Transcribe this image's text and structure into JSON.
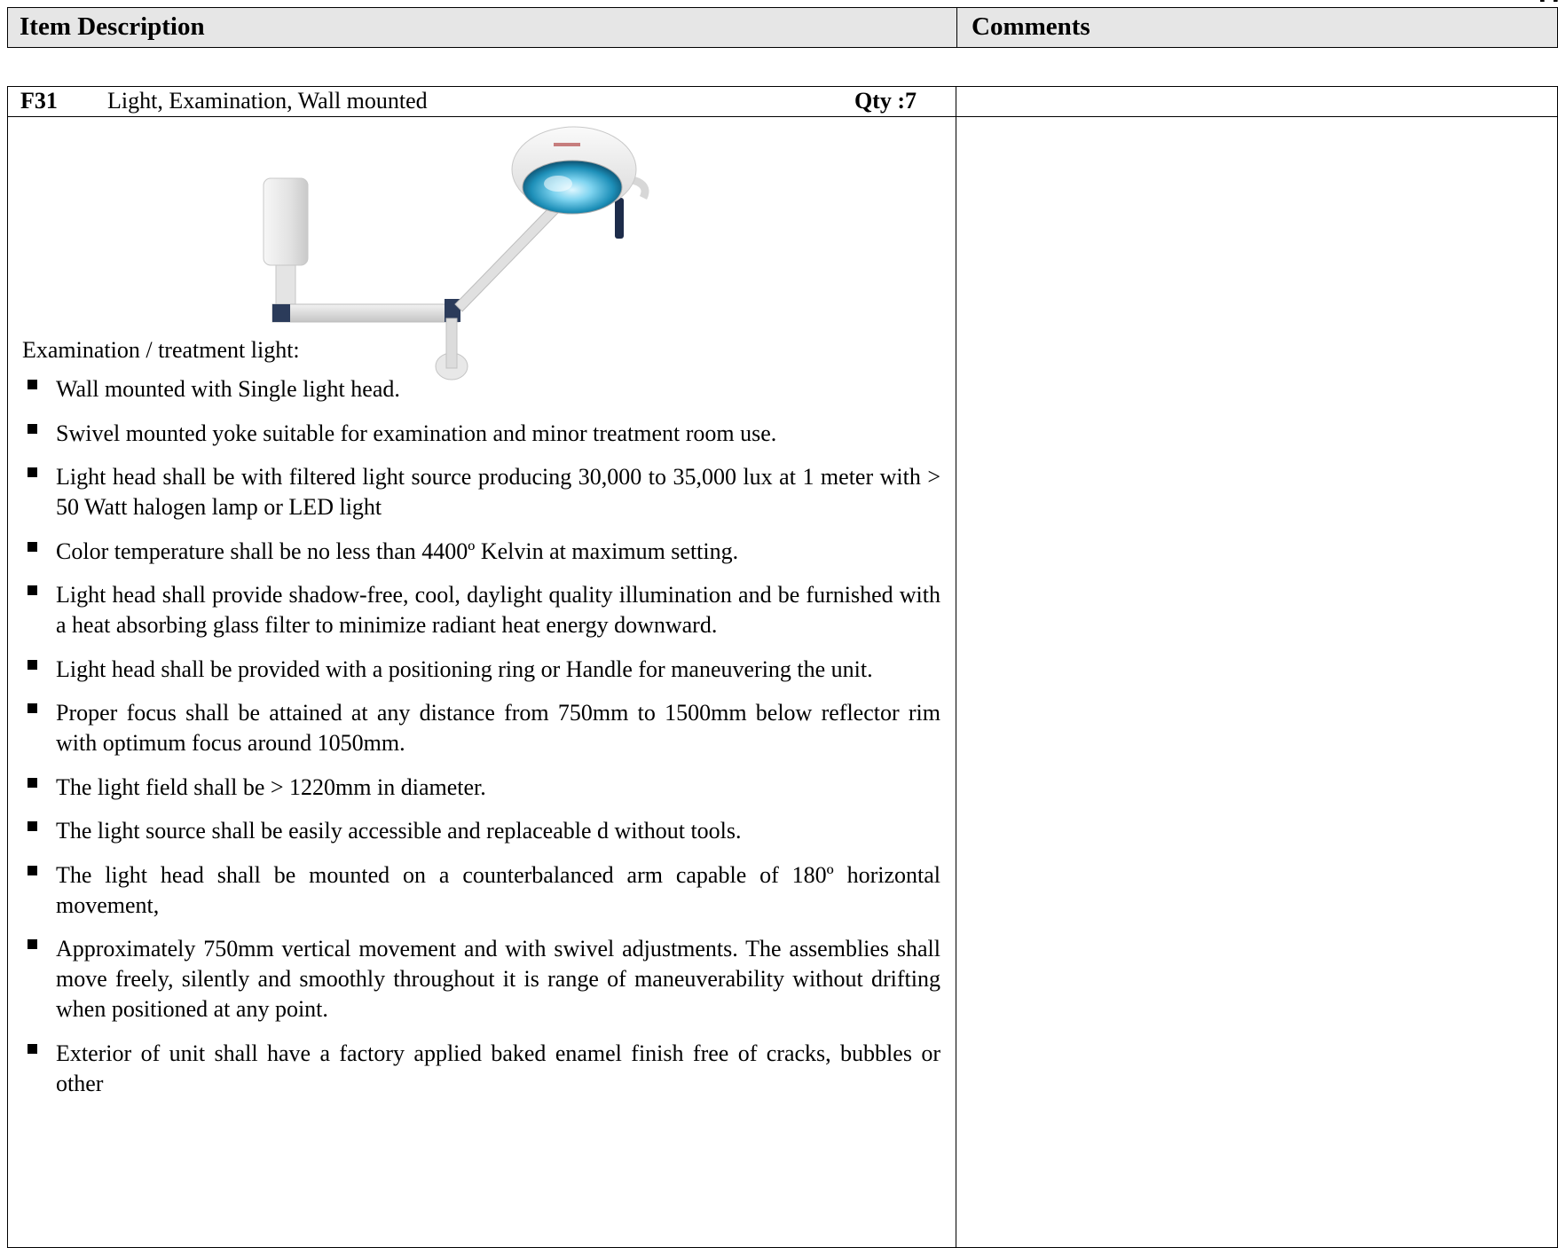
{
  "header": {
    "col_item_description": "Item Description",
    "col_comments": "Comments",
    "corner_mark": "Q"
  },
  "item": {
    "code": "F31",
    "name": "Light, Examination, Wall mounted",
    "qty_label": "Qty :7",
    "image": "wall-mounted-examination-light-photo",
    "intro": "Examination / treatment light:",
    "specs": [
      "Wall mounted with Single light head.",
      "Swivel mounted yoke suitable for examination and minor treatment room use.",
      "Light head shall be with filtered light source producing 30,000 to 35,000 lux at 1 meter with > 50 Watt halogen lamp or LED light",
      "Color temperature shall be no less than 4400º Kelvin at maximum setting.",
      "Light head shall provide shadow-free, cool, daylight quality illumination and be furnished with a heat absorbing glass filter to minimize radiant heat energy downward.",
      "Light head shall be provided with a positioning ring or Handle for maneuvering the unit.",
      "Proper focus shall be attained at any distance from 750mm to 1500mm below reflector rim with optimum focus around 1050mm.",
      "The light field shall be > 1220mm in diameter.",
      "The light source shall be easily accessible and replaceable d without tools.",
      "The light head shall be mounted on a counterbalanced arm capable of 180º horizontal movement,",
      "Approximately 750mm vertical movement and with swivel adjustments. The assemblies shall move freely, silently and smoothly throughout it is range of maneuverability without drifting when positioned at any point.",
      " Exterior of unit shall have a factory applied baked enamel finish free of cracks, bubbles or other"
    ],
    "comments": ""
  }
}
